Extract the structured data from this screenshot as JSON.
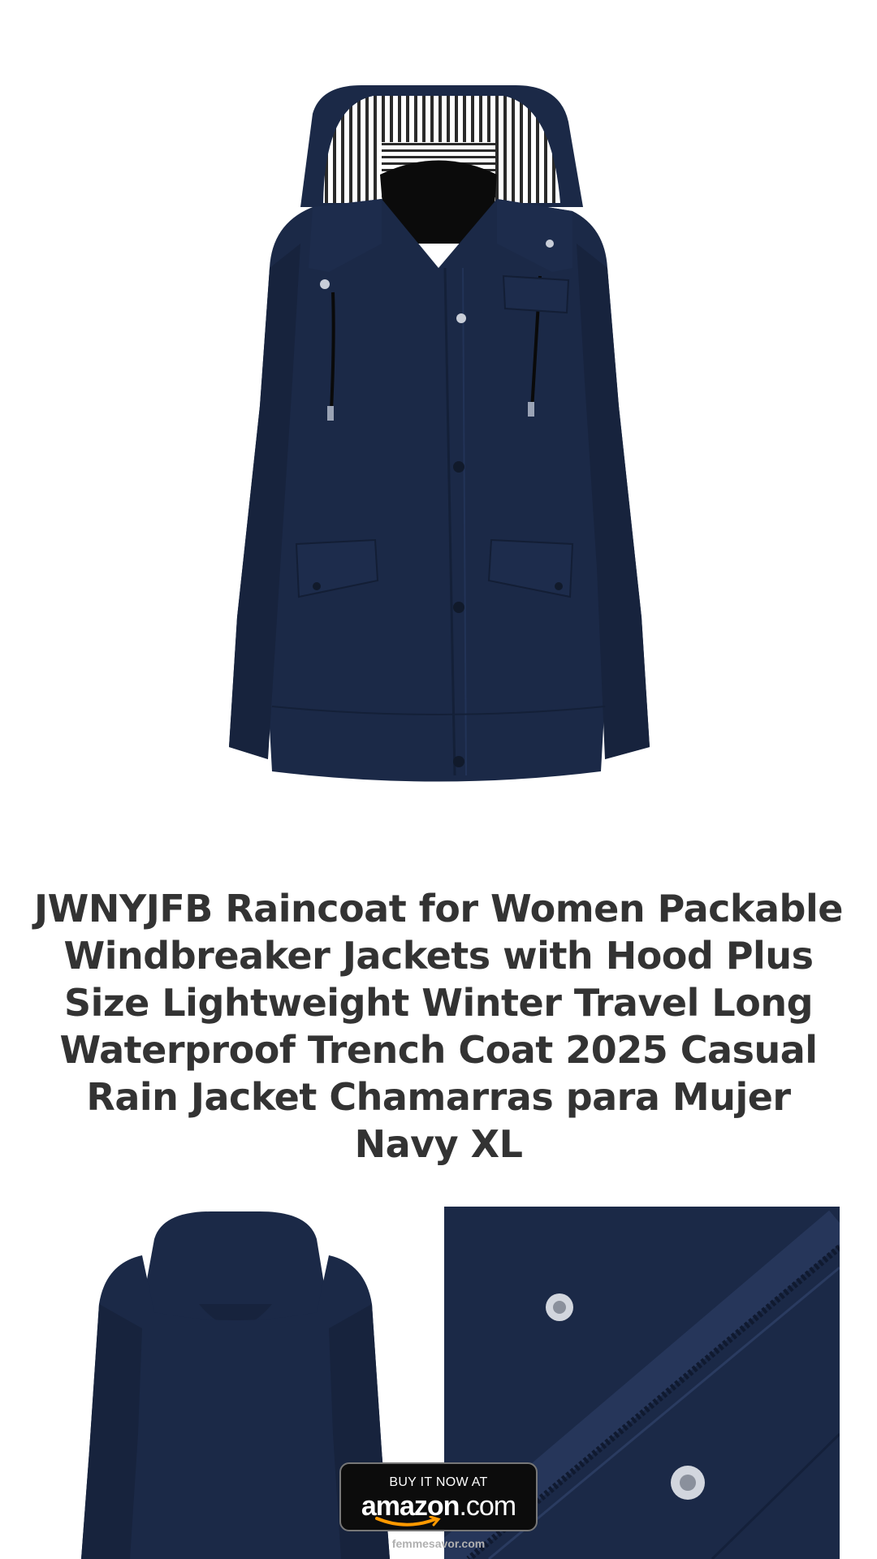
{
  "product": {
    "title": "JWNYJFB Raincoat for Women Packable Windbreaker Jackets with Hood Plus Size Lightweight Winter Travel Long Waterproof Trench Coat 2025 Casual Rain Jacket Chamarras para Mujer Navy XL",
    "color": "#1b2947"
  },
  "cta": {
    "top_label": "BUY IT NOW AT",
    "brand": "amazon",
    "brand_tld": ".com",
    "accent": "#ff9900"
  },
  "footer": {
    "watermark": "femmesavor.com"
  },
  "icons": {
    "hero": "navy-jacket-front-image",
    "back": "navy-jacket-back-image",
    "detail": "zipper-snap-closeup-image",
    "smile": "amazon-smile-icon"
  }
}
